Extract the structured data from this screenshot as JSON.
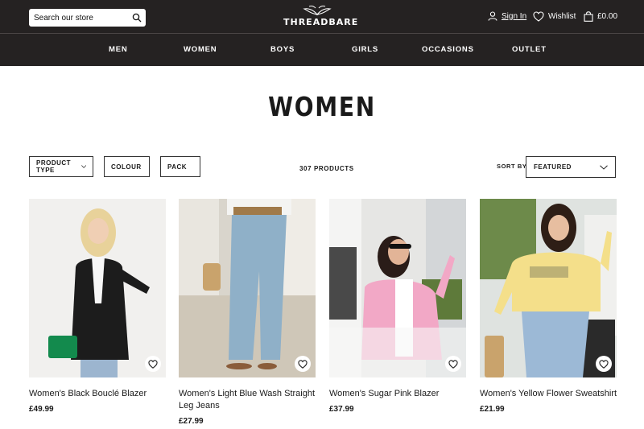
{
  "header": {
    "search_placeholder": "Search our store",
    "logo_text": "THREADBARE",
    "sign_in": "Sign In",
    "wishlist": "Wishlist",
    "basket_total": "£0.00"
  },
  "nav": {
    "items": [
      "MEN",
      "WOMEN",
      "BOYS",
      "GIRLS",
      "OCCASIONS",
      "OUTLET"
    ]
  },
  "page": {
    "title": "WOMEN",
    "product_count": "307 PRODUCTS",
    "sort_label": "SORT BY",
    "sort_value": "FEATURED"
  },
  "filters": [
    "PRODUCT TYPE",
    "COLOUR",
    "PACK"
  ],
  "products": [
    {
      "name": "Women's Black Bouclé Blazer",
      "price": "£49.99"
    },
    {
      "name": "Women's Light Blue Wash Straight Leg Jeans",
      "price": "£27.99"
    },
    {
      "name": "Women's Sugar Pink Blazer",
      "price": "£37.99"
    },
    {
      "name": "Women's Yellow Flower Sweatshirt",
      "price": "£21.99"
    }
  ],
  "colors": {
    "header_bg": "#252222",
    "text": "#1a1a1a"
  },
  "icons": [
    "search-icon",
    "logo-wings-icon",
    "user-icon",
    "heart-icon",
    "bag-icon",
    "chevron-down-icon"
  ]
}
